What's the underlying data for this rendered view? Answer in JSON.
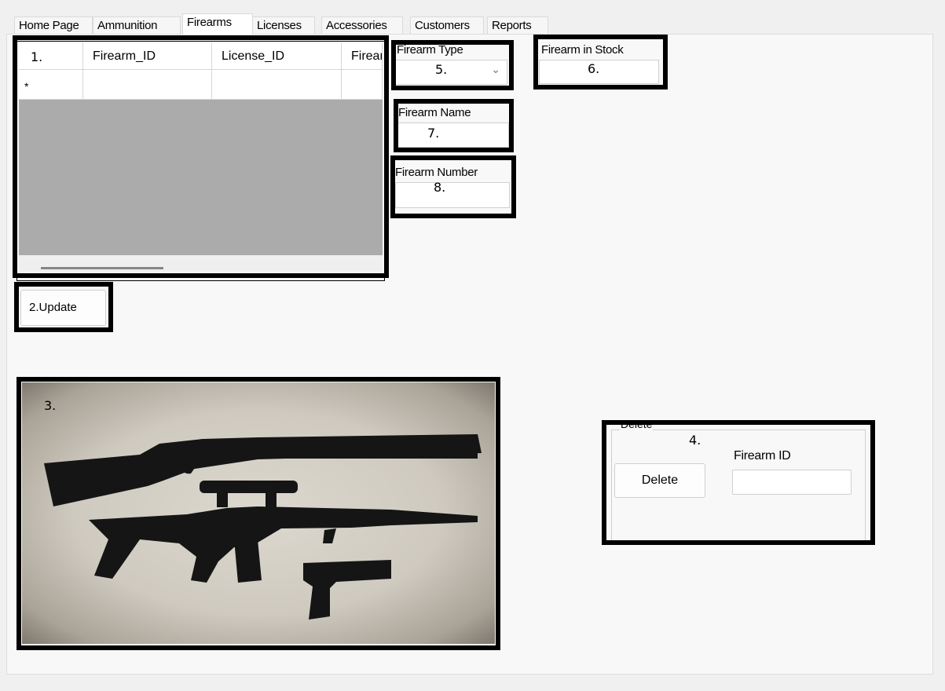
{
  "tabs": [
    "Home Page",
    "Ammunition",
    "Firearms",
    "Licenses",
    "Accessories",
    "Customers",
    "Reports"
  ],
  "active_tab": "Firearms",
  "grid": {
    "columns": [
      "Firearm_ID",
      "License_ID",
      "Firear"
    ],
    "new_row_glyph": "*"
  },
  "fields": {
    "firearm_type": {
      "label": "Firearm Type",
      "value": ""
    },
    "firearm_in_stock": {
      "label": "Firearm in Stock",
      "value": ""
    },
    "firearm_name": {
      "label": "Firearm Name",
      "value": ""
    },
    "firearm_number": {
      "label": "Firearm Number",
      "value": ""
    }
  },
  "update_button": "Update",
  "delete_group": {
    "title": "Delete",
    "button": "Delete",
    "id_label": "Firearm ID",
    "id_value": ""
  },
  "annotations": [
    "1.",
    "2.",
    "3.",
    "4.",
    "5.",
    "6.",
    "7.",
    "8."
  ]
}
